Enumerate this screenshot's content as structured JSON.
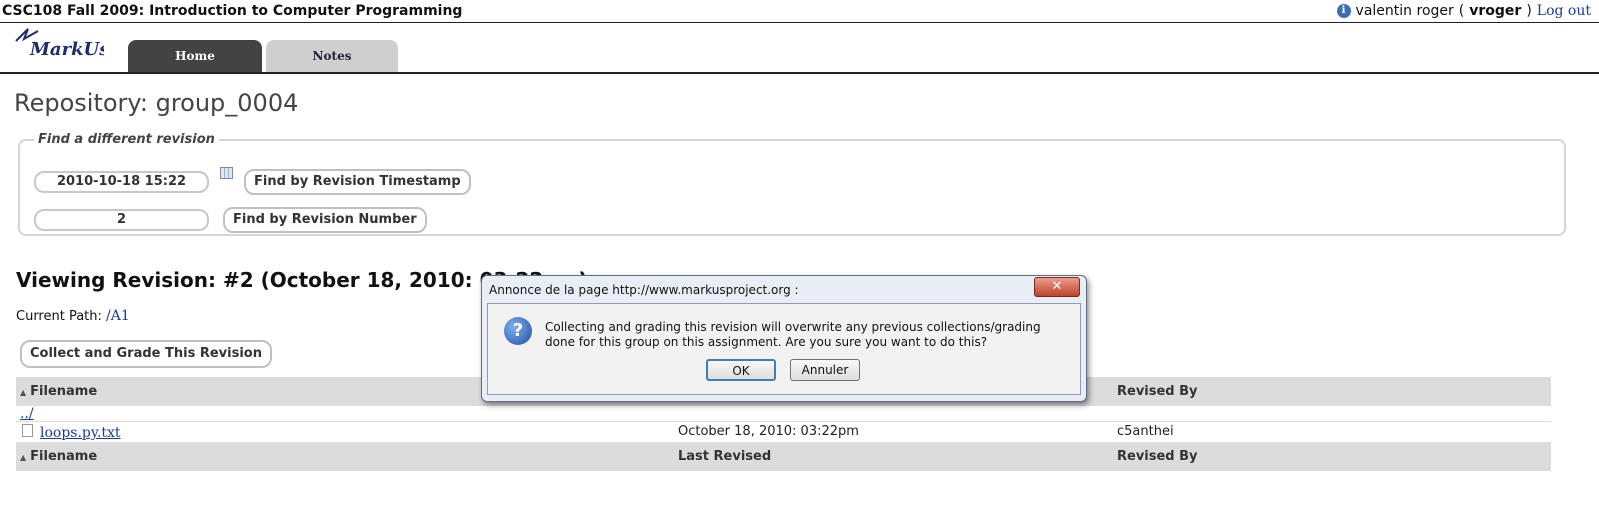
{
  "topbar": {
    "course_title": "CSC108 Fall 2009: Introduction to Computer Programming",
    "user_name": "valentin roger",
    "open_paren": "(",
    "user_id": "vroger",
    "close_paren": ")",
    "logout_label": "Log out"
  },
  "nav": {
    "logo_text": "MarkUs",
    "tabs": [
      {
        "label": "Home",
        "active": true
      },
      {
        "label": "Notes",
        "active": false
      }
    ]
  },
  "repo": {
    "title": "Repository: group_0004"
  },
  "finder": {
    "legend": "Find a different revision",
    "timestamp_value": "2010-10-18 15:22",
    "timestamp_button": "Find by Revision Timestamp",
    "number_value": "2",
    "number_button": "Find by Revision Number"
  },
  "revision": {
    "heading": "Viewing Revision: #2 (October 18, 2010: 03:22pm)",
    "current_path_label": "Current Path:",
    "current_path": "/A1",
    "collect_button": "Collect and Grade This Revision"
  },
  "table": {
    "columns": [
      "Filename",
      "Last Revised",
      "Revised By"
    ],
    "parent_link": "../",
    "rows": [
      {
        "filename": "loops.py.txt",
        "last_revised": "October 18, 2010: 03:22pm",
        "revised_by": "c5anthei"
      }
    ]
  },
  "dialog": {
    "title": "Annonce de la page http://www.markusproject.org  :",
    "close_glyph": "✕",
    "message": "Collecting and grading this revision will overwrite any previous collections/grading done for this group on this assignment.  Are you sure you want to do this?",
    "ok_label": "OK",
    "cancel_label": "Annuler"
  },
  "icons": {
    "info": "info-icon",
    "calendar": "calendar-icon",
    "question": "question-icon",
    "file": "file-icon",
    "sort": "sort-arrow-icon"
  },
  "colors": {
    "link": "#1a3d8f",
    "active_tab": "#434343",
    "inactive_tab": "#cfcfcf",
    "table_header": "#dcdcdc"
  }
}
